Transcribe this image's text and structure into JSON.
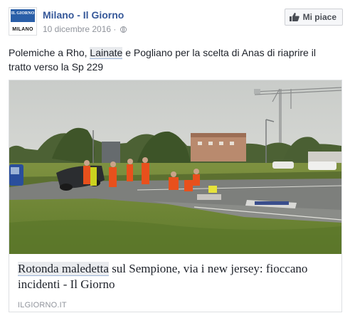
{
  "page": {
    "name": "Milano - Il Giorno",
    "avatar_brand": "IL GIORNO",
    "avatar_city": "MILANO",
    "date": "10 dicembre 2016",
    "meta_separator": "·",
    "like_label": "Mi piace"
  },
  "post": {
    "text_before": "Polemiche a Rho, ",
    "text_highlight": "Lainate",
    "text_after": " e Pogliano per la scelta di Anas di riaprire il tratto verso la Sp 229"
  },
  "link": {
    "headline_highlight": "Rotonda maledetta",
    "headline_rest": " sul Sempione, via i new jersey: fioccano incidenti - Il Giorno",
    "domain": "ILGIORNO.IT"
  },
  "colors": {
    "link_blue": "#365899",
    "meta_grey": "#90949c",
    "text": "#1d2129",
    "avatar_blue": "#2a5fa8",
    "rescuer_orange": "#e8501c"
  },
  "icons": {
    "like": "thumbs-up-icon",
    "audience": "globe-icon"
  }
}
